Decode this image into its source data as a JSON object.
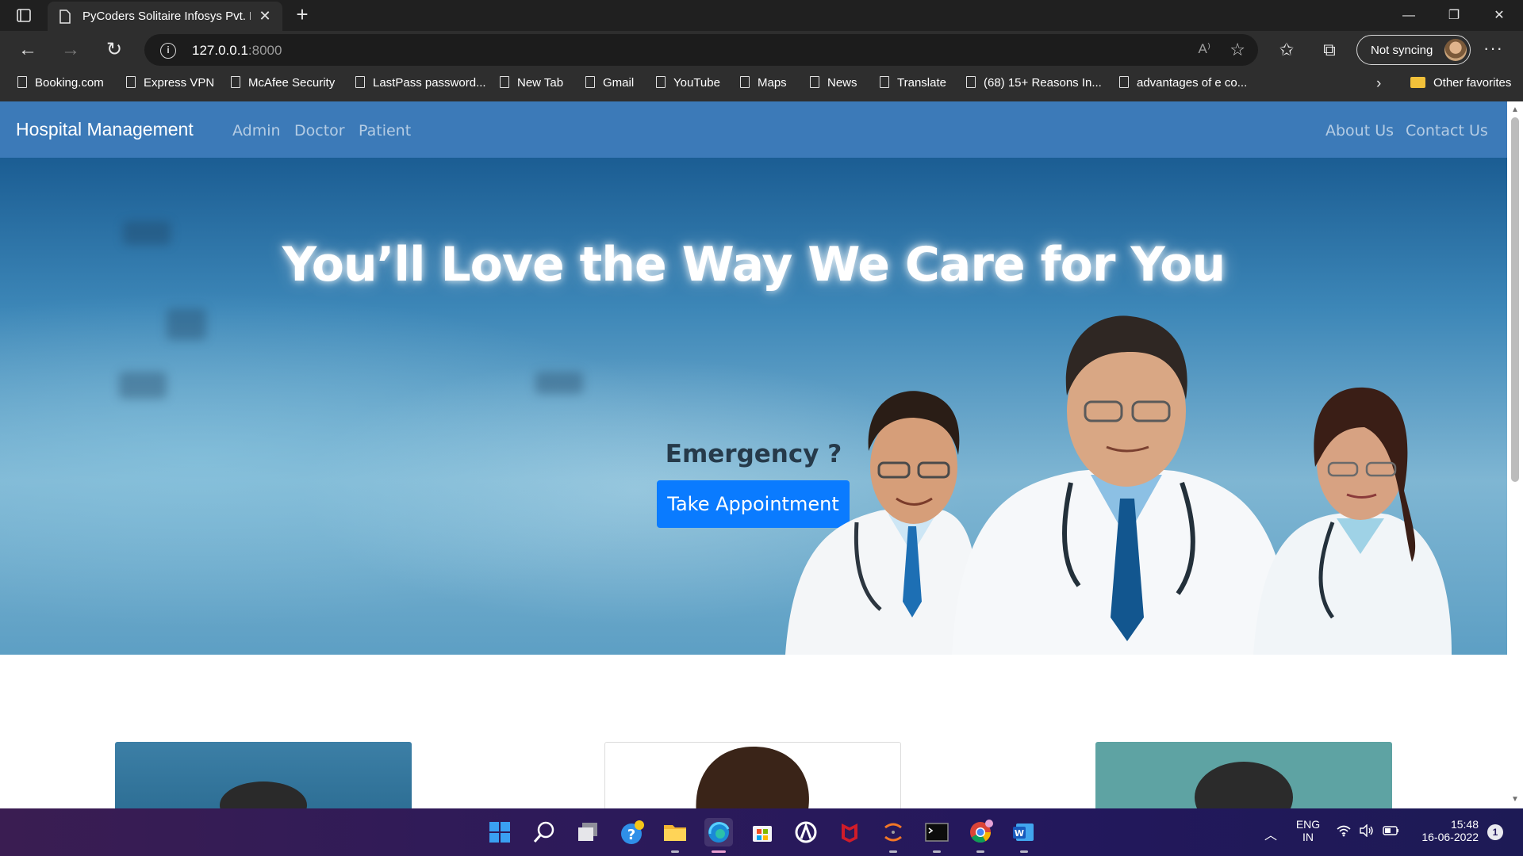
{
  "browser": {
    "tab_title": "PyCoders Solitaire Infosys Pvt. Ltd",
    "tab_close_glyph": "✕",
    "new_tab_glyph": "+",
    "window_controls": [
      "—",
      "❐",
      "✕"
    ],
    "url_host": "127.0.0.1",
    "url_port": ":8000",
    "read_aloud_glyph": "A⁾",
    "profile_label": "Not syncing",
    "more_glyph": "···"
  },
  "favorites": {
    "items": [
      "Booking.com",
      "Express VPN",
      "McAfee Security",
      "LastPass password...",
      "New Tab",
      "Gmail",
      "YouTube",
      "Maps",
      "News",
      "Translate",
      "(68) 15+ Reasons In...",
      "advantages of e co..."
    ],
    "more_glyph": "›",
    "other_label": "Other favorites"
  },
  "site": {
    "brand": "Hospital Management",
    "nav_left": [
      "Admin",
      "Doctor",
      "Patient"
    ],
    "nav_right": [
      "About Us",
      "Contact Us"
    ],
    "hero_title": "You’ll Love the Way We Care for You",
    "emergency_label": "Emergency ?",
    "appointment_button": "Take Appointment",
    "colors": {
      "navbar": "#3c7ab8",
      "button": "#0a7bff"
    }
  },
  "taskbar": {
    "apps": [
      "start",
      "search",
      "task-view",
      "help",
      "file-explorer",
      "edge",
      "microsoft-store",
      "app-circle",
      "mcafee",
      "ide",
      "terminal",
      "chrome",
      "word"
    ],
    "language_top": "ENG",
    "language_bottom": "IN",
    "time": "15:48",
    "date": "16-06-2022",
    "notification_count": "1"
  }
}
